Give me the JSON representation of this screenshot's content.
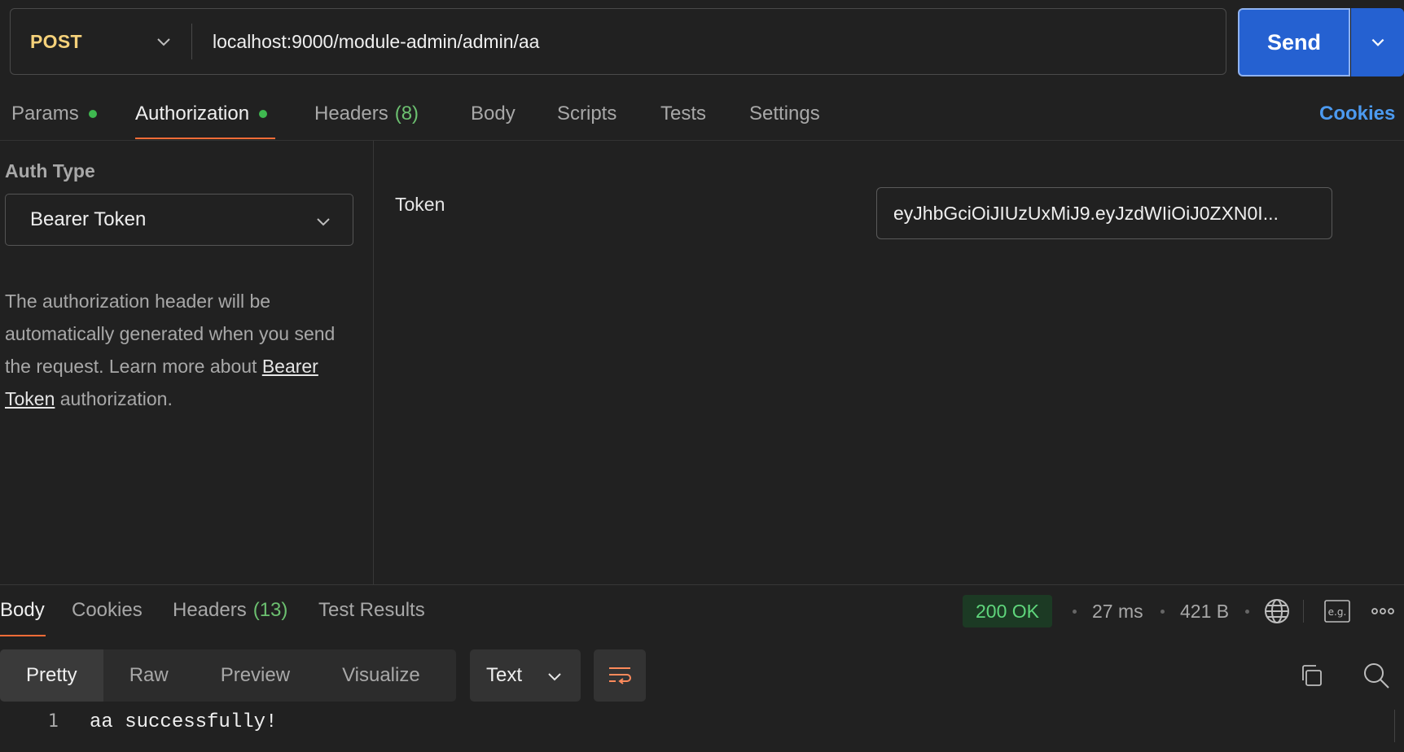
{
  "request": {
    "method": "POST",
    "url": "localhost:9000/module-admin/admin/aa",
    "send_label": "Send"
  },
  "tabs": [
    {
      "label": "Params",
      "dot": true
    },
    {
      "label": "Authorization",
      "dot": true,
      "active": true
    },
    {
      "label": "Headers",
      "count": "(8)"
    },
    {
      "label": "Body"
    },
    {
      "label": "Scripts"
    },
    {
      "label": "Tests"
    },
    {
      "label": "Settings"
    }
  ],
  "cookies_link": "Cookies",
  "auth": {
    "type_label": "Auth Type",
    "type_value": "Bearer Token",
    "help_text_1": "The authorization header will be automatically generated when you send the request. Learn more about ",
    "help_link": "Bearer Token",
    "help_text_2": " authorization.",
    "token_label": "Token",
    "token_value": "eyJhbGciOiJIUzUxMiJ9.eyJzdWIiOiJ0ZXN0I..."
  },
  "response": {
    "tabs": [
      {
        "label": "Body",
        "active": true
      },
      {
        "label": "Cookies"
      },
      {
        "label": "Headers",
        "count": "(13)"
      },
      {
        "label": "Test Results"
      }
    ],
    "status": "200 OK",
    "time": "27 ms",
    "size": "421 B",
    "example_icon_text": "e.g.",
    "views": [
      "Pretty",
      "Raw",
      "Preview",
      "Visualize"
    ],
    "format": "Text",
    "lines": [
      {
        "num": "1",
        "text": "aa successfully!"
      }
    ]
  },
  "colors": {
    "accent_orange": "#ff6c37",
    "send_blue": "#2561d1",
    "method_yellow": "#f5d17a",
    "status_green": "#5fd67c",
    "dot_green": "#3fb950",
    "link_blue": "#4c9af0"
  }
}
